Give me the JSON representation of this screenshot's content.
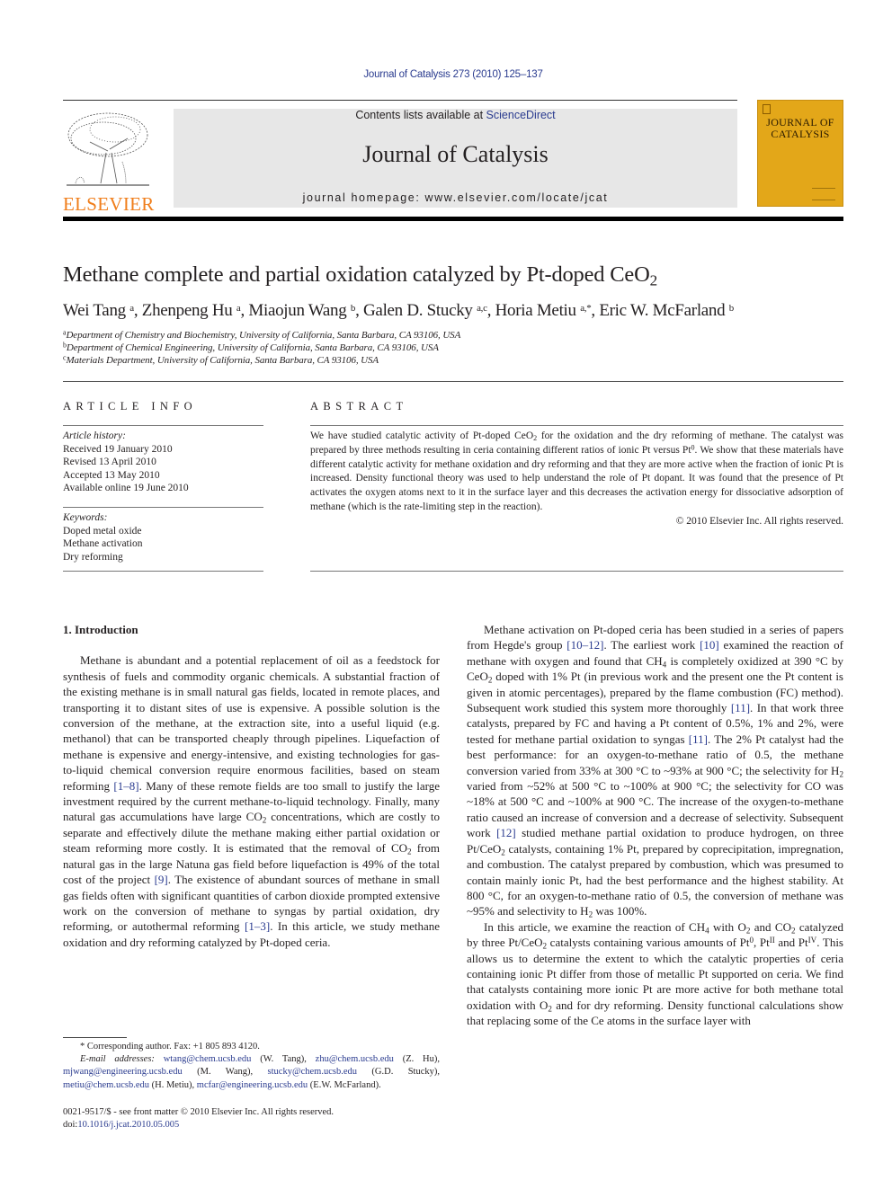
{
  "header": {
    "citation": "Journal of Catalysis 273 (2010) 125–137",
    "contents_prefix": "Contents lists available at ",
    "contents_link": "ScienceDirect",
    "journal_name": "Journal of Catalysis",
    "homepage_prefix": "journal homepage: ",
    "homepage_url": "www.elsevier.com/locate/jcat",
    "publisher_logo_text": "ELSEVIER",
    "cover_title_line1": "JOURNAL OF",
    "cover_title_line2": "CATALYSIS",
    "colors": {
      "elsevier_orange": "#f07e1b",
      "link_blue": "#2a3b8f",
      "cover_gold": "#e3a719",
      "masthead_gray": "#e7e7e7"
    }
  },
  "article": {
    "title_main": "Methane complete and partial oxidation catalyzed by Pt-doped CeO",
    "title_sub": "2",
    "authors": [
      {
        "name": "Wei Tang",
        "sup": "a",
        "sep": ", "
      },
      {
        "name": "Zhenpeng Hu",
        "sup": "a",
        "sep": ", "
      },
      {
        "name": "Miaojun Wang",
        "sup": "b",
        "sep": ", "
      },
      {
        "name": "Galen D. Stucky",
        "sup": "a,c",
        "sep": ", "
      },
      {
        "name": "Horia Metiu",
        "sup": "a,*",
        "sep": ", "
      },
      {
        "name": "Eric W. McFarland",
        "sup": "b",
        "sep": ""
      }
    ],
    "affiliations": [
      {
        "key": "a",
        "text": "Department of Chemistry and Biochemistry, University of California, Santa Barbara, CA 93106, USA"
      },
      {
        "key": "b",
        "text": "Department of Chemical Engineering, University of California, Santa Barbara, CA 93106, USA"
      },
      {
        "key": "c",
        "text": "Materials Department, University of California, Santa Barbara, CA 93106, USA"
      }
    ]
  },
  "article_info": {
    "heading": "ARTICLE INFO",
    "history_label": "Article history:",
    "history": [
      "Received 19 January 2010",
      "Revised 13 April 2010",
      "Accepted 13 May 2010",
      "Available online 19 June 2010"
    ],
    "keywords_label": "Keywords:",
    "keywords": [
      "Doped metal oxide",
      "Methane activation",
      "Dry reforming"
    ]
  },
  "abstract": {
    "heading": "ABSTRACT",
    "p1a": "We have studied catalytic activity of Pt-doped CeO",
    "p1b": " for the oxidation and the dry reforming of methane. The catalyst was prepared by three methods resulting in ceria containing different ratios of ionic Pt versus Pt",
    "p1c": ". We show that these materials have different catalytic activity for methane oxidation and dry reforming and that they are more active when the fraction of ionic Pt is increased. Density functional theory was used to help understand the role of Pt dopant. It was found that the presence of Pt activates the oxygen atoms next to it in the surface layer and this decreases the activation energy for dissociative adsorption of methane (which is the rate-limiting step in the reaction).",
    "copyright": "© 2010 Elsevier Inc. All rights reserved."
  },
  "body": {
    "section_heading": "1. Introduction",
    "left": {
      "p1_s1": "Methane is abundant and a potential replacement of oil as a feedstock for synthesis of fuels and commodity organic chemicals. A substantial fraction of the existing methane is in small natural gas fields, located in remote places, and transporting it to distant sites of use is expensive. A possible solution is the conversion of the methane, at the extraction site, into a useful liquid (e.g. methanol) that can be transported cheaply through pipelines. Liquefaction of methane is expensive and energy-intensive, and existing technologies for gas-to-liquid chemical conversion require enormous facilities, based on steam reforming ",
      "ref_1_8": "[1–8]",
      "p1_s2": ". Many of these remote fields are too small to justify the large investment required by the current methane-to-liquid technology. Finally, many natural gas accumulations have large CO",
      "p1_s3": " concentrations, which are costly to separate and effectively dilute the methane making either partial oxidation or steam reforming more costly. It is estimated that the removal of CO",
      "p1_s4": " from natural gas in the large Natuna gas field before liquefaction is 49% of the total cost of the project ",
      "ref_9": "[9]",
      "p1_s5": ". The existence of abundant sources of methane in small gas fields often with significant quantities of carbon dioxide prompted extensive work on the conversion of methane to syngas by partial oxidation, dry reforming, or autothermal reforming ",
      "ref_1_3": "[1–3]",
      "p1_s6": ". In this article, we study methane oxidation and dry reforming catalyzed by Pt-doped ceria."
    },
    "right": {
      "p1_s1": "Methane activation on Pt-doped ceria has been studied in a series of papers from Hegde's group ",
      "ref_10_12": "[10–12]",
      "p1_s2": ". The earliest work ",
      "ref_10": "[10]",
      "p1_s3": " examined the reaction of methane with oxygen and found that CH",
      "p1_s4": " is completely oxidized at 390 °C by CeO",
      "p1_s5": " doped with 1% Pt (in previous work and the present one the Pt content is given in atomic percentages), prepared by the flame combustion (FC) method). Subsequent work studied this system more thoroughly ",
      "ref_11a": "[11]",
      "p1_s6": ". In that work three catalysts, prepared by FC and having a Pt content of 0.5%, 1% and 2%, were tested for methane partial oxidation to syngas ",
      "ref_11b": "[11]",
      "p1_s7": ". The 2% Pt catalyst had the best performance: for an oxygen-to-methane ratio of 0.5, the methane conversion varied from 33% at 300 °C to ~93% at 900 °C; the selectivity for H",
      "p1_s8": " varied from ~52% at 500 °C to ~100% at 900 °C; the selectivity for CO was ~18% at 500 °C and ~100% at 900 °C. The increase of the oxygen-to-methane ratio caused an increase of conversion and a decrease of selectivity. Subsequent work ",
      "ref_12": "[12]",
      "p1_s9": " studied methane partial oxidation to produce hydrogen, on three Pt/CeO",
      "p1_s10": " catalysts, containing 1% Pt, prepared by coprecipitation, impregnation, and combustion. The catalyst prepared by combustion, which was presumed to contain mainly ionic Pt, had the best performance and the highest stability. At 800 °C, for an oxygen-to-methane ratio of 0.5, the conversion of methane was ~95% and selectivity to H",
      "p1_s11": " was 100%.",
      "p2_s1": "In this article, we examine the reaction of CH",
      "p2_s2": " with O",
      "p2_s3": " and CO",
      "p2_s4": " catalyzed by three Pt/CeO",
      "p2_s5": " catalysts containing various amounts of Pt",
      "p2_s6": ", Pt",
      "p2_s7": " and Pt",
      "p2_s8": ". This allows us to determine the extent to which the catalytic properties of ceria containing ionic Pt differ from those of metallic Pt supported on ceria. We find that catalysts containing more ionic Pt are more active for both methane total oxidation with O",
      "p2_s9": " and for dry reforming. Density functional calculations show that replacing some of the Ce atoms in the surface layer with",
      "sub_2": "2",
      "sub_4": "4",
      "sup_0": "0",
      "sup_II": "II",
      "sup_IV": "IV"
    }
  },
  "footnote": {
    "star_line": "* Corresponding author. Fax: +1 805 893 4120.",
    "email_label": "E-mail addresses: ",
    "emails": [
      {
        "address": "wtang@chem.ucsb.edu",
        "who": " (W. Tang), "
      },
      {
        "address": "zhu@chem.ucsb.edu",
        "who": " (Z. Hu), "
      },
      {
        "address": "mjwang@engineering.ucsb.edu",
        "who": " (M. Wang), "
      },
      {
        "address": "stucky@chem.ucsb.edu",
        "who": " (G.D. Stucky), "
      },
      {
        "address": "metiu@chem.ucsb.edu",
        "who": " (H. Metiu), "
      },
      {
        "address": "mcfar@engineering.ucsb.edu",
        "who": " (E.W. McFarland)."
      }
    ],
    "front_matter": "0021-9517/$ - see front matter © 2010 Elsevier Inc. All rights reserved.",
    "doi_prefix": "doi:",
    "doi": "10.1016/j.jcat.2010.05.005"
  }
}
